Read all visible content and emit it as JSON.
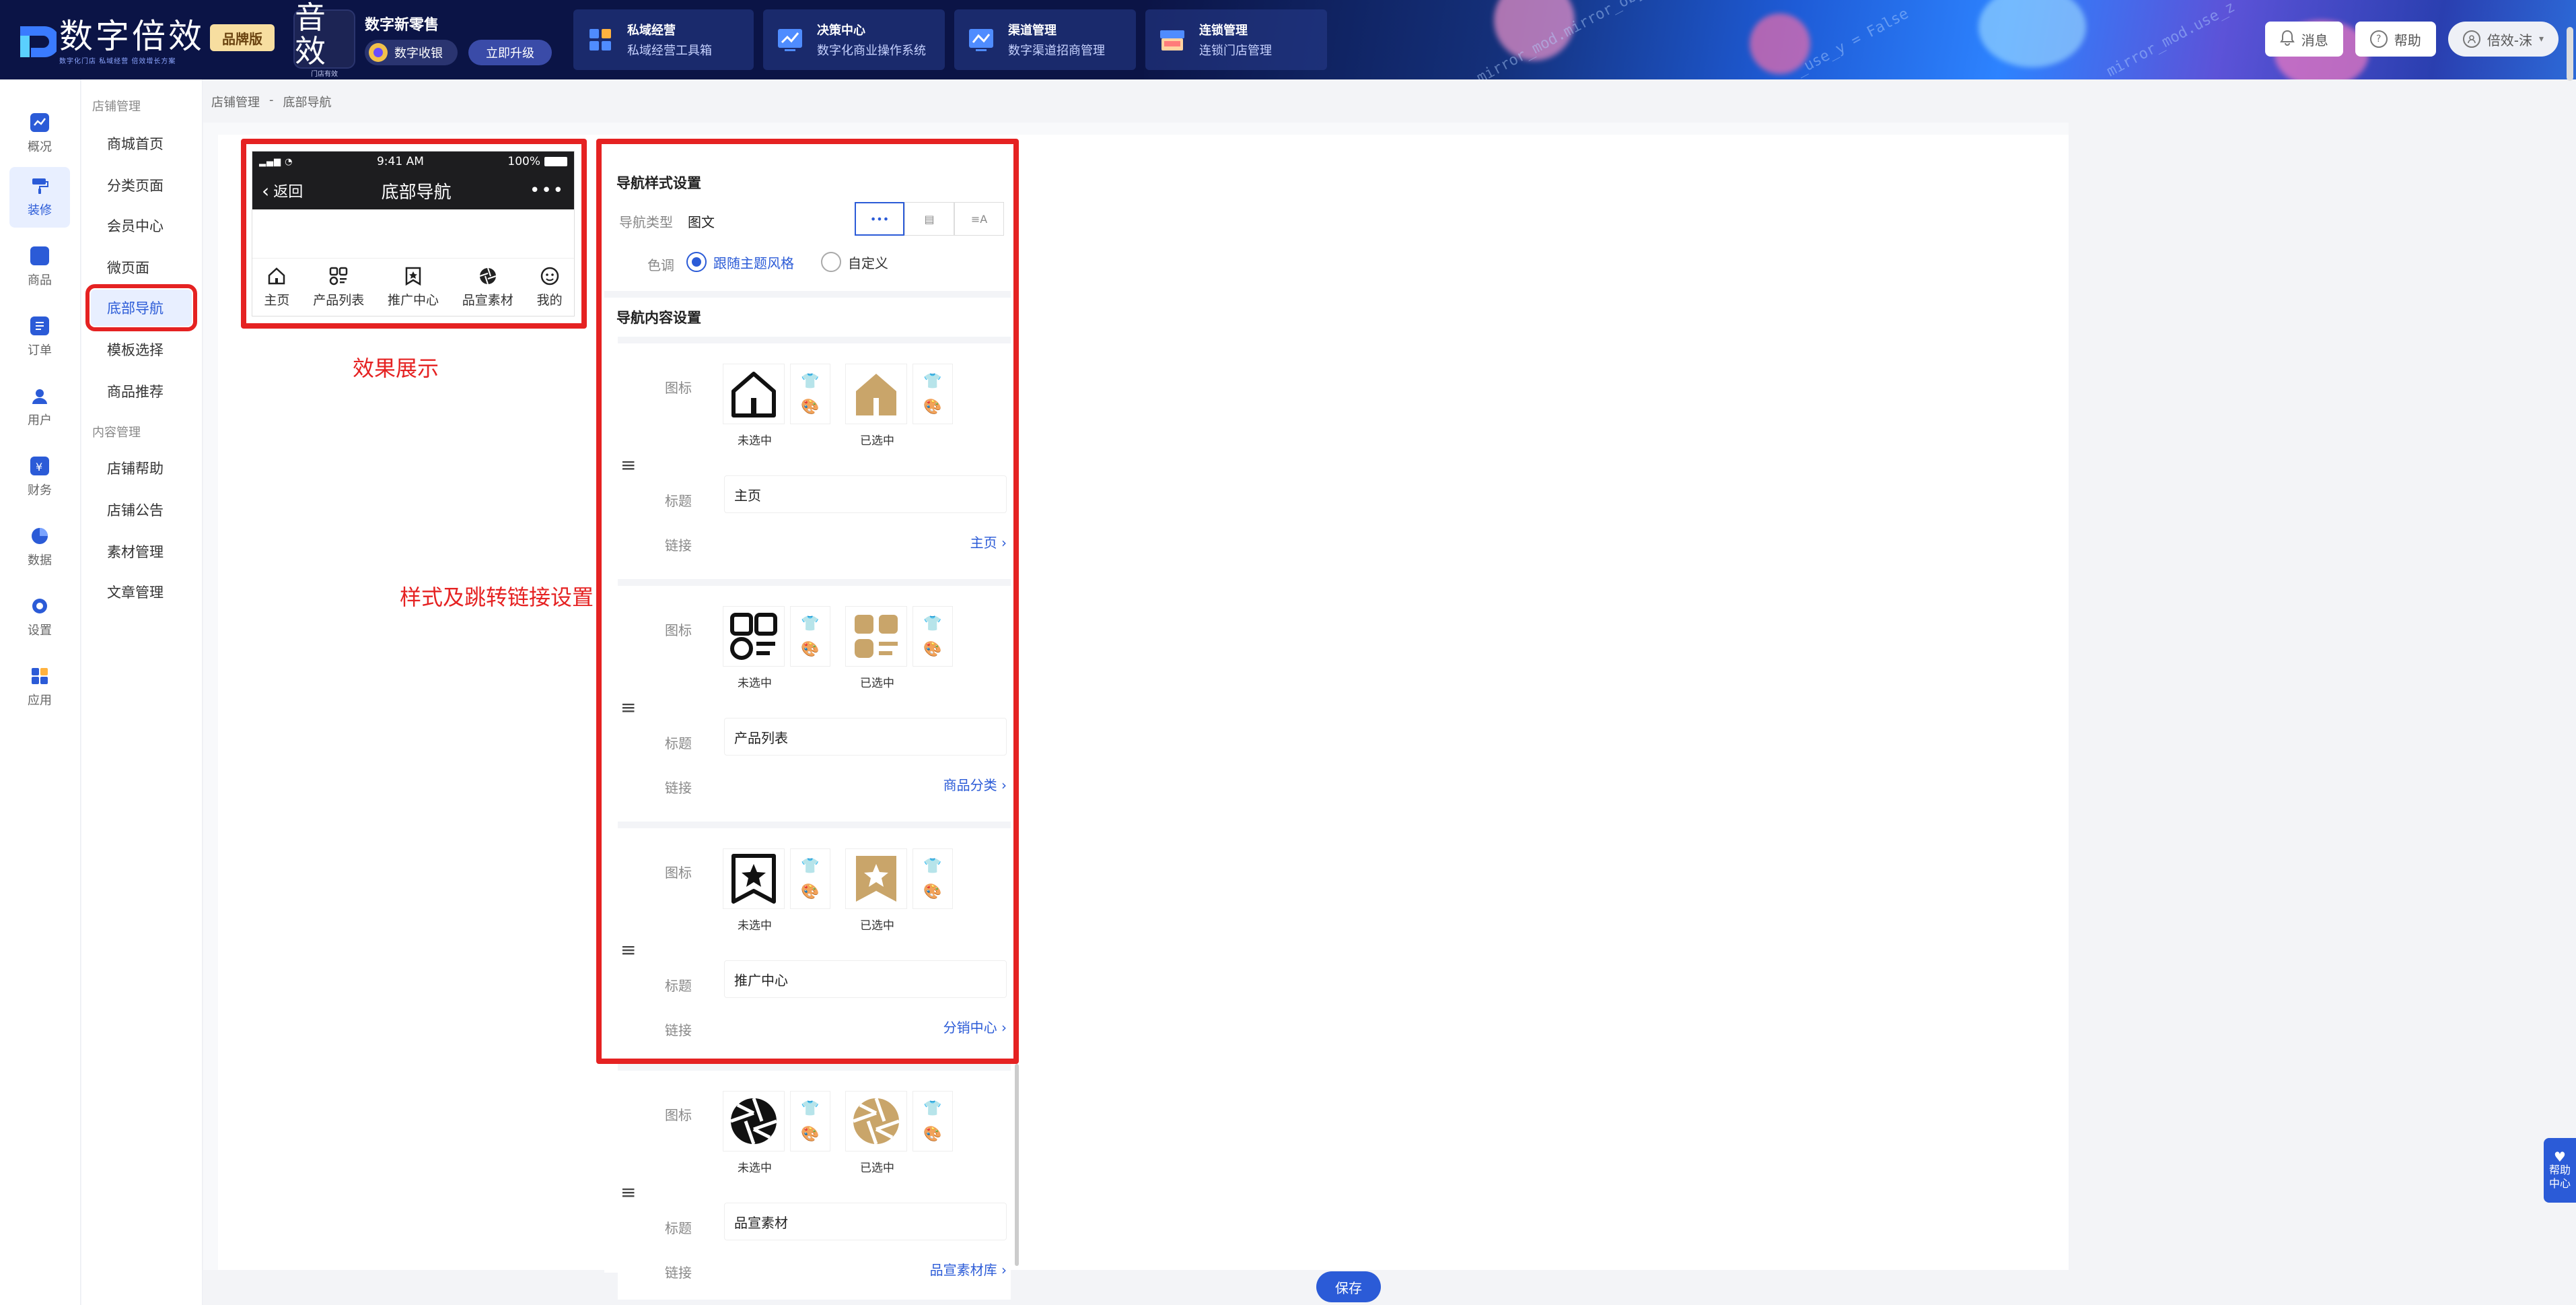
{
  "top_bar": {
    "logo_text": "数字倍效",
    "logo_sub": "数字化门店  私域经营  倍效增长方案",
    "brand_badge": "品牌版",
    "product": {
      "icon_big": "音效",
      "icon_small": "门店有效",
      "title": "数字新零售",
      "pill": "数字收银",
      "upgrade": "立即升级"
    },
    "menus": [
      {
        "title": "私域经营",
        "sub": "私域经营工具箱",
        "icon": "grid-icon",
        "color": "#ffb23f"
      },
      {
        "title": "决策中心",
        "sub": "数字化商业操作系统",
        "icon": "chart-icon",
        "color": "#4f8cff"
      },
      {
        "title": "渠道管理",
        "sub": "数字渠道招商管理",
        "icon": "chart-icon",
        "color": "#4f8cff"
      },
      {
        "title": "连锁管理",
        "sub": "连锁门店管理",
        "icon": "store-icon",
        "color": "#ff6b6b"
      }
    ],
    "actions": {
      "message": "消息",
      "help": "帮助",
      "user": "倍效-沫"
    }
  },
  "rail": [
    {
      "label": "概况",
      "active": false
    },
    {
      "label": "装修",
      "active": true
    },
    {
      "label": "商品",
      "active": false
    },
    {
      "label": "订单",
      "active": false
    },
    {
      "label": "用户",
      "active": false
    },
    {
      "label": "财务",
      "active": false
    },
    {
      "label": "数据",
      "active": false
    },
    {
      "label": "设置",
      "active": false
    },
    {
      "label": "应用",
      "active": false
    }
  ],
  "subnav": {
    "group1": "店铺管理",
    "items1": [
      "商城首页",
      "分类页面",
      "会员中心",
      "微页面",
      "底部导航",
      "模板选择",
      "商品推荐"
    ],
    "group2": "内容管理",
    "items2": [
      "店铺帮助",
      "店铺公告",
      "素材管理",
      "文章管理"
    ]
  },
  "breadcrumb": {
    "parent": "店铺管理",
    "sep": "-",
    "current": "底部导航"
  },
  "phone": {
    "time": "9:41 AM",
    "battery": "100%",
    "back": "返回",
    "title": "底部导航",
    "more": "•••",
    "tabs": [
      "主页",
      "产品列表",
      "推广中心",
      "品宣素材",
      "我的"
    ]
  },
  "annotations": {
    "preview": "效果展示",
    "settings": "样式及跳转链接设置"
  },
  "settings": {
    "style_title": "导航样式设置",
    "type_label": "导航类型",
    "type_value": "图文",
    "style_tabs": [
      "•••",
      "▤",
      "≡A"
    ],
    "tone_label": "色调",
    "tone_options": [
      "跟随主题风格",
      "自定义"
    ],
    "content_title": "导航内容设置",
    "icon_label": "图标",
    "title_label": "标题",
    "link_label": "链接",
    "unselected": "未选中",
    "selected": "已选中",
    "items": [
      {
        "title": "主页",
        "link": "主页"
      },
      {
        "title": "产品列表",
        "link": "商品分类"
      },
      {
        "title": "推广中心",
        "link": "分销中心"
      },
      {
        "title": "品宣素材",
        "link": "品宣素材库"
      }
    ]
  },
  "save": "保存",
  "help_float": "帮助中心",
  "colors": {
    "accent": "#2b5bd7",
    "gold": "#c9a56a",
    "annotation_red": "#e52222",
    "topbar": "#0b1446"
  }
}
